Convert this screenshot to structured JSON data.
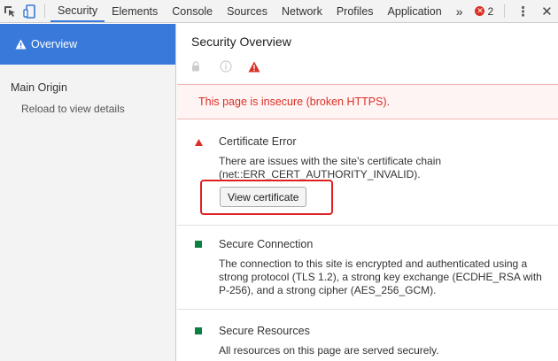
{
  "toolbar": {
    "tabs": [
      "Security",
      "Elements",
      "Console",
      "Sources",
      "Network",
      "Profiles",
      "Application"
    ],
    "more": "»",
    "error_count": "2",
    "kebab": "⋮",
    "close": "✕"
  },
  "sidebar": {
    "overview_label": "Overview",
    "main_origin_label": "Main Origin",
    "reload_text": "Reload to view details"
  },
  "main": {
    "title": "Security Overview",
    "banner_text": "This page is insecure (broken HTTPS).",
    "sections": [
      {
        "heading": "Certificate Error",
        "text": "There are issues with the site's certificate chain (net::ERR_CERT_AUTHORITY_INVALID).",
        "button": "View certificate"
      },
      {
        "heading": "Secure Connection",
        "text": "The connection to this site is encrypted and authenticated using a strong protocol (TLS 1.2), a strong key exchange (ECDHE_RSA with P-256), and a strong cipher (AES_256_GCM)."
      },
      {
        "heading": "Secure Resources",
        "text": "All resources on this page are served securely."
      }
    ]
  },
  "colors": {
    "accent": "#3879d9",
    "insecure": "#d93025",
    "secure": "#0b8043"
  }
}
